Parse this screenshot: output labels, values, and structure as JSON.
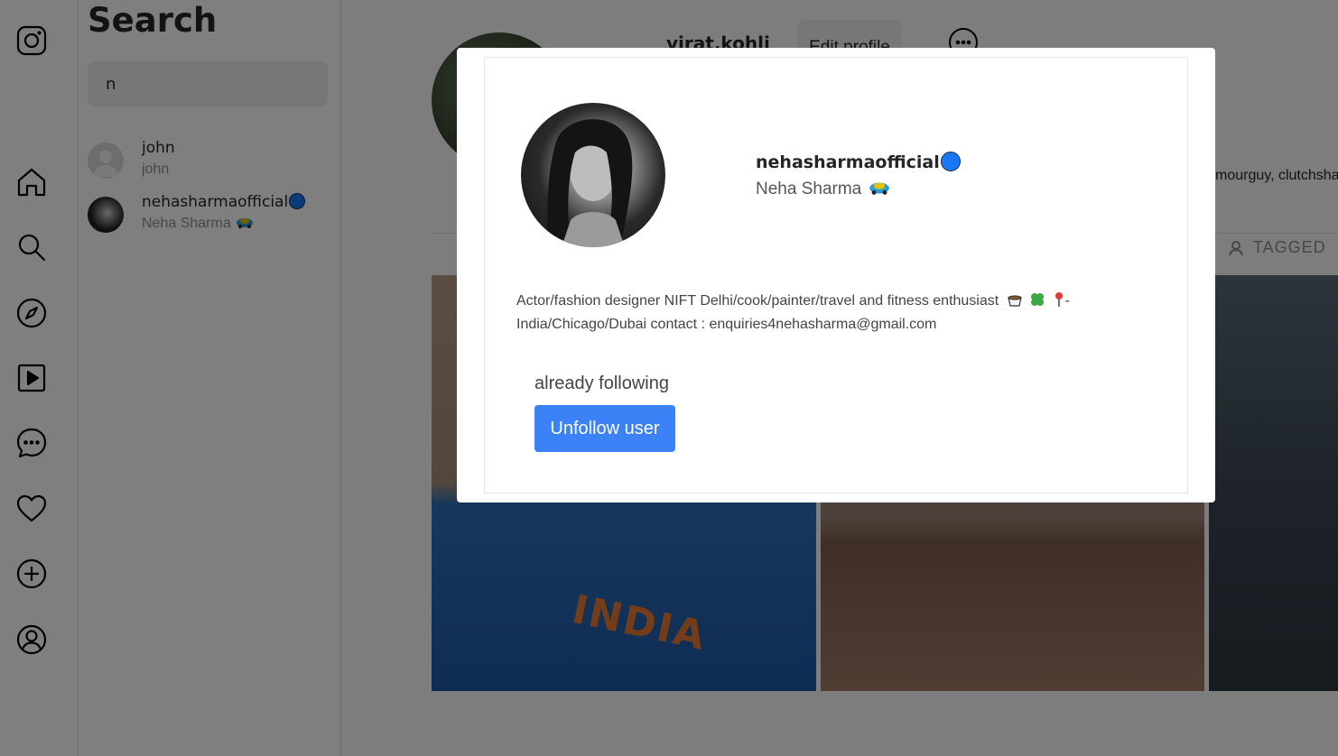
{
  "rail": {
    "icons": [
      "instagram-logo-icon",
      "home-icon",
      "search-icon",
      "explore-icon",
      "reels-icon",
      "messages-icon",
      "heart-icon",
      "create-icon",
      "profile-icon"
    ]
  },
  "search": {
    "title": "Search",
    "query": "n",
    "results": [
      {
        "username": "john",
        "fullname": "john"
      },
      {
        "username": "nehasharmaofficial",
        "fullname": "Neha Sharma"
      }
    ]
  },
  "profile": {
    "username": "virat.kohli",
    "edit_label": "Edit profile",
    "following_snippet": "mourguy, clutchsha",
    "tagged_label": "TAGGED",
    "post1_text": "INDIA"
  },
  "modal": {
    "username": "nehasharmaofficial",
    "fullname": "Neha Sharma",
    "bio_line1": "Actor/fashion designer NIFT Delhi/cook/painter/travel and fitness enthusiast",
    "bio_line1_end": "-",
    "bio_line2": "India/Chicago/Dubai contact : enquiries4nehasharma@gmail.com",
    "status": "already following",
    "button_label": "Unfollow user"
  },
  "colors": {
    "accent": "#3b82f6",
    "verified_badge": "#1877f2",
    "input_bg": "#efefef"
  }
}
